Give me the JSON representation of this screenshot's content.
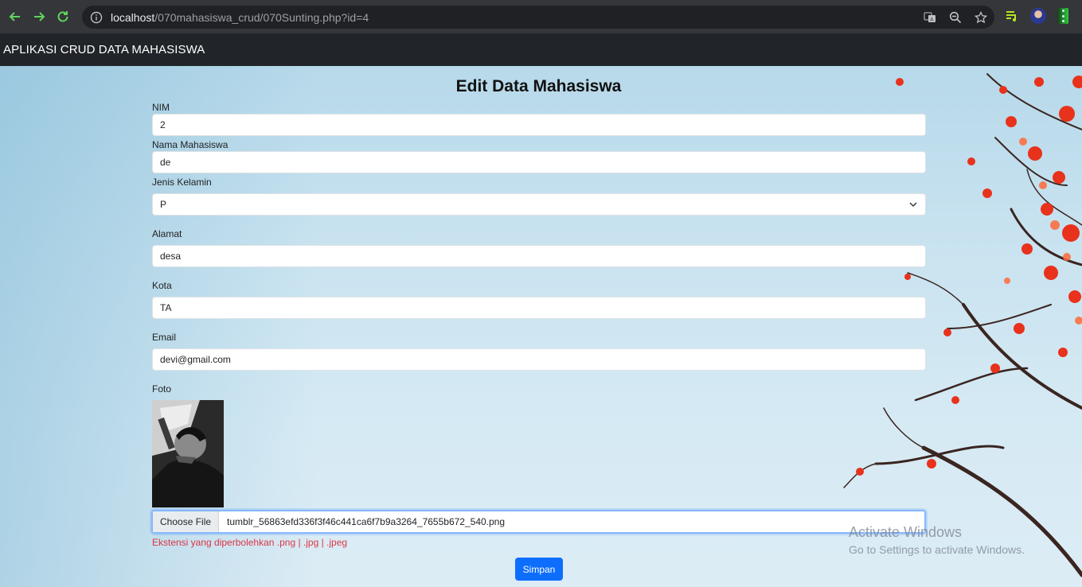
{
  "browser": {
    "url_host": "localhost",
    "url_path": "/070mahasiswa_crud/070Sunting.php?id=4"
  },
  "navbar": {
    "brand": "APLIKASI CRUD DATA MAHASISWA"
  },
  "form": {
    "title": "Edit Data Mahasiswa",
    "nim": {
      "label": "NIM",
      "value": "2"
    },
    "nama": {
      "label": "Nama Mahasiswa",
      "value": "de"
    },
    "jenis_kelamin": {
      "label": "Jenis Kelamin",
      "value": "P"
    },
    "alamat": {
      "label": "Alamat",
      "value": "desa"
    },
    "kota": {
      "label": "Kota",
      "value": "TA"
    },
    "email": {
      "label": "Email",
      "value": "devi@gmail.com"
    },
    "foto": {
      "label": "Foto",
      "choose_label": "Choose File",
      "file_name": "tumblr_56863efd336f3f46c441ca6f7b9a3264_7655b672_540.png",
      "hint": "Ekstensi yang diperbolehkan .png | .jpg | .jpeg"
    },
    "submit_label": "Simpan"
  },
  "watermark": {
    "line1": "Activate Windows",
    "line2": "Go to Settings to activate Windows."
  },
  "icons": {
    "back": "arrow-left-icon",
    "forward": "arrow-right-icon",
    "reload": "reload-icon",
    "info": "info-icon",
    "translate": "translate-icon",
    "zoom": "zoom-icon",
    "star": "star-icon",
    "playlist": "playlist-icon",
    "menu": "menu-dots-icon"
  },
  "colors": {
    "primary": "#0d6efd",
    "danger": "#dc3545",
    "navbar": "#212529"
  }
}
